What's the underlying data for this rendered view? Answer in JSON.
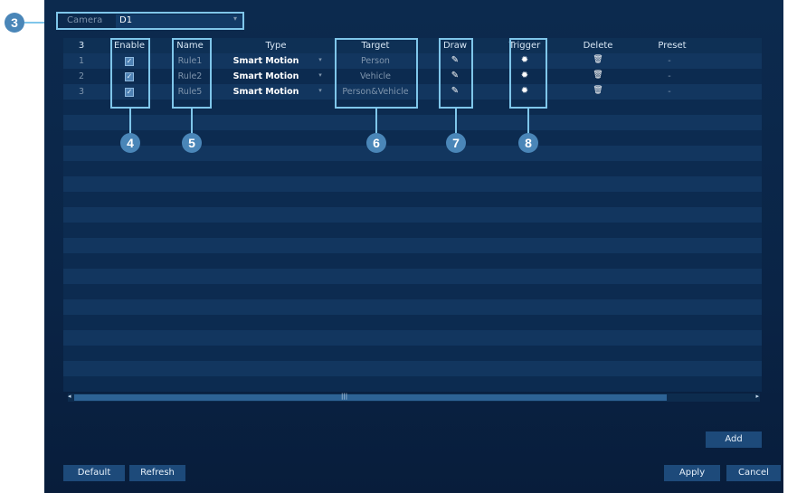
{
  "camera": {
    "label": "Camera",
    "value": "D1"
  },
  "table": {
    "headers": [
      "3",
      "Enable",
      "Name",
      "Type",
      "Target",
      "Draw",
      "Trigger",
      "Delete",
      "Preset"
    ],
    "rows": [
      {
        "index": "1",
        "enabled": true,
        "name": "Rule1",
        "type": "Smart Motion",
        "target": "Person",
        "preset": "-"
      },
      {
        "index": "2",
        "enabled": true,
        "name": "Rule2",
        "type": "Smart Motion",
        "target": "Vehicle",
        "preset": "-"
      },
      {
        "index": "3",
        "enabled": true,
        "name": "Rule5",
        "type": "Smart Motion",
        "target": "Person&Vehicle",
        "preset": "-"
      }
    ],
    "icons": {
      "draw": "pencil-icon",
      "trigger": "gear-icon",
      "delete": "trash-icon"
    }
  },
  "callouts": [
    "3",
    "4",
    "5",
    "6",
    "7",
    "8"
  ],
  "scrollbar": {
    "grip": "|||"
  },
  "buttons": {
    "add": "Add",
    "default": "Default",
    "refresh": "Refresh",
    "apply": "Apply",
    "cancel": "Cancel"
  },
  "colors": {
    "panel": "#0a2446",
    "highlight": "#7fc6ea",
    "callout": "#4a86b8",
    "button": "#1d4a7a"
  }
}
